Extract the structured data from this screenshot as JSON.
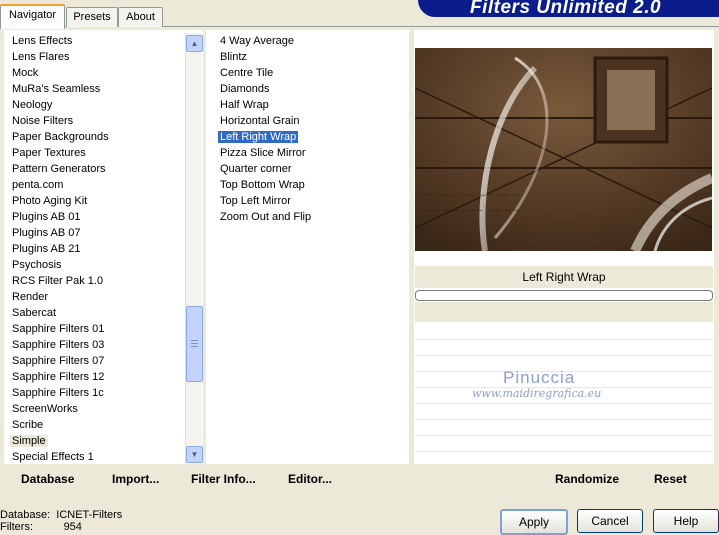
{
  "tabs": [
    "Navigator",
    "Presets",
    "About"
  ],
  "app_title": "Filters Unlimited 2.0",
  "categories": [
    "Lens Effects",
    "Lens Flares",
    "Mock",
    "MuRa's Seamless",
    "Neology",
    "Noise Filters",
    "Paper Backgrounds",
    "Paper Textures",
    "Pattern Generators",
    "penta.com",
    "Photo Aging Kit",
    "Plugins AB 01",
    "Plugins AB 07",
    "Plugins AB 21",
    "Psychosis",
    "RCS Filter Pak 1.0",
    "Render",
    "Sabercat",
    "Sapphire Filters 01",
    "Sapphire Filters 03",
    "Sapphire Filters 07",
    "Sapphire Filters 12",
    "Sapphire Filters 1c",
    "ScreenWorks",
    "Scribe",
    "Simple",
    "Special Effects 1"
  ],
  "selected_category": "Simple",
  "filters": [
    "4 Way Average",
    "Blintz",
    "Centre Tile",
    "Diamonds",
    "Half Wrap",
    "Horizontal Grain",
    "Left Right Wrap",
    "Pizza Slice Mirror",
    "Quarter corner",
    "Top Bottom Wrap",
    "Top Left Mirror",
    "Zoom Out and Flip"
  ],
  "selected_filter": "Left Right Wrap",
  "toolbar": {
    "database": "Database",
    "import": "Import...",
    "filter_info": "Filter Info...",
    "editor": "Editor..."
  },
  "right_toolbar": {
    "randomize": "Randomize",
    "reset": "Reset"
  },
  "preview_filter_name": "Left Right Wrap",
  "watermark": {
    "name": "Pinuccia",
    "site": "www.maidiregrafica.eu"
  },
  "status": {
    "database_label": "Database:",
    "database_value": "ICNET-Filters",
    "filters_label": "Filters:",
    "filters_value": "954"
  },
  "buttons": {
    "apply": "Apply",
    "cancel": "Cancel",
    "help": "Help"
  },
  "scroll_position": 0.62
}
